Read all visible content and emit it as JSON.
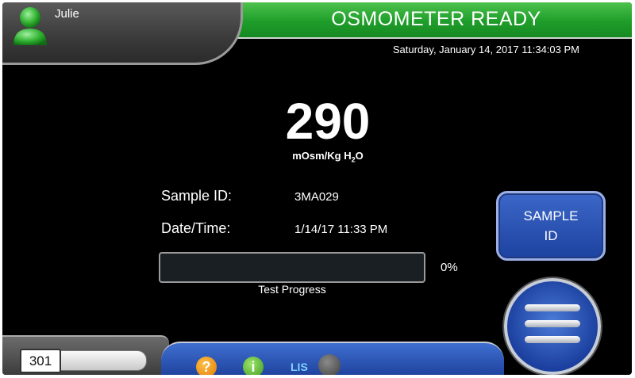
{
  "status": {
    "title": "OSMOMETER READY"
  },
  "user": {
    "name": "Julie"
  },
  "datetime": "Saturday, January 14, 2017 11:34:03 PM",
  "reading": {
    "value": "290",
    "unit_prefix": "mOsm/Kg H",
    "unit_sub": "2",
    "unit_suffix": "O"
  },
  "sample": {
    "id_label": "Sample ID:",
    "id_value": "3MA029",
    "dt_label": "Date/Time:",
    "dt_value": "1/14/17 11:33 PM"
  },
  "progress": {
    "percent": 0,
    "percent_text": "0%",
    "label": "Test Progress"
  },
  "buttons": {
    "sample_id_line1": "SAMPLE",
    "sample_id_line2": "ID"
  },
  "bottom": {
    "counter": "301",
    "help_glyph": "?",
    "info_glyph": "i",
    "lis": "LIS"
  },
  "colors": {
    "status_green": "#1f9d2a",
    "button_blue": "#2a52b5",
    "background": "#000000"
  }
}
